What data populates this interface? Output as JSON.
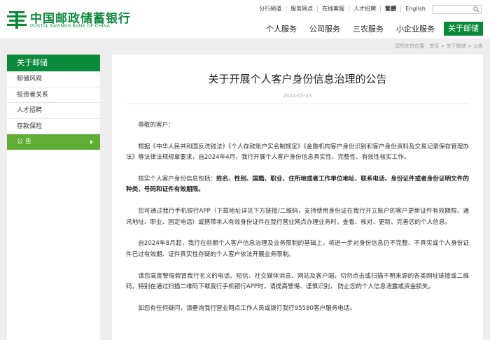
{
  "brand": {
    "name_cn": "中国邮政储蓄银行",
    "name_en": "POSTAL SAVINGS BANK OF CHINA",
    "color": "#0b8a3b"
  },
  "toplinks": [
    "分行频道",
    "服务网点",
    "在线客服",
    "人才招聘",
    "繁體",
    "English"
  ],
  "search": {
    "placeholder": ""
  },
  "nav": [
    "个人服务",
    "公司服务",
    "三农服务",
    "小企业服务",
    "关于邮储"
  ],
  "breadcrumb": "您所在的位置：首页 > 关于邮储 > 公告",
  "sidebar": {
    "title": "关于邮储",
    "items": [
      "邮储风观",
      "投资者关系",
      "人才招聘",
      "存款保险",
      "公 告"
    ]
  },
  "article": {
    "title": "关于开展个人客户身份信息治理的公告",
    "date": "2024-05-23",
    "greeting": "尊敬的客户：",
    "p1": "根据《中华人民共和国反洗钱法》《个人存款账户实名制规定》《金融机构客户身份识别和客户身份资料及交易记录保存管理办法》等法律法规规章要求，自2024年4月，我行开展个人客户身份信息真实性、完整性、有效性核实工作。",
    "p2_prefix": "核实个人客户身份信息包括：",
    "p2_bold": "姓名、性别、国籍、职业、住所地或者工作单位地址、联系电话、身份证件或者身份证明文件的种类、号码和证件有效期限。",
    "p3": "您可通过我行手机银行APP（下载地址详见下方链接/二维码，支持使用身份证在我行开立账户的客户更新证件有效期限、通讯地址、职业、固定电话）或携带本人有效身份证件在我行营业网点办理业务时，查看、核对、更新、完善您的个人信息。",
    "p4": "自2024年8月起，我行在前期个人客户信息治理及业务限制的基础上，将进一步对身份信息仍不完整、不真实或个人身份证件已过有效期、证件真实性存疑的个人客户依法开展业务限制。",
    "p5": "请您高度警惕假冒我行名义的电话、短信、社交媒体消息、网站及客户端，切勿点击或扫描不明来源的各类网址链接或二维码，特别在通过扫描二维码下载我行手机银行APP时，请提高警惕、谨慎识别， 防止您的个人信息泄露或资金损失。",
    "p6": "如您有任何疑问，请垂询我行营业网点工作人员或拨打我行95580客户服务电话。"
  }
}
